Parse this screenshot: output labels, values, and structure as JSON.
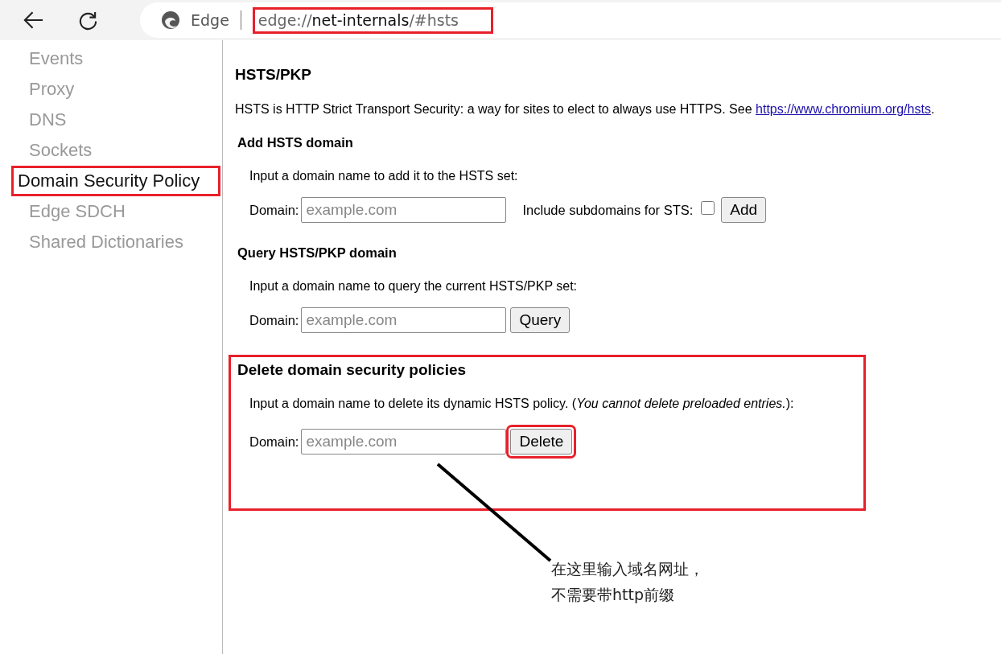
{
  "toolbar": {
    "brand": "Edge",
    "url": {
      "scheme": "edge://",
      "host": "net-internals",
      "path": "/#hsts",
      "highlighted": true
    }
  },
  "sidebar": {
    "items": [
      {
        "label": "Events",
        "selected": false,
        "highlighted": false
      },
      {
        "label": "Proxy",
        "selected": false,
        "highlighted": false
      },
      {
        "label": "DNS",
        "selected": false,
        "highlighted": false
      },
      {
        "label": "Sockets",
        "selected": false,
        "highlighted": false
      },
      {
        "label": "Domain Security Policy",
        "selected": true,
        "highlighted": true
      },
      {
        "label": "Edge SDCH",
        "selected": false,
        "highlighted": false
      },
      {
        "label": "Shared Dictionaries",
        "selected": false,
        "highlighted": false
      }
    ]
  },
  "page": {
    "title": "HSTS/PKP",
    "intro": "HSTS is HTTP Strict Transport Security: a way for sites to elect to always use HTTPS. See",
    "intro_link": "https://www.chromium.org/hsts",
    "intro_end": ".",
    "sections": [
      {
        "kind": "add",
        "heading": "Add HSTS domain",
        "description": "Input a domain name to add it to the HSTS set:",
        "highlighted": false,
        "domain_label": "Domain:",
        "placeholder": "example.com",
        "checkbox_label": "Include subdomains for STS:",
        "checked": false,
        "button": {
          "label": "Add",
          "highlighted": false
        }
      },
      {
        "kind": "query",
        "heading": "Query HSTS/PKP domain",
        "description": "Input a domain name to query the current HSTS/PKP set:",
        "highlighted": false,
        "domain_label": "Domain:",
        "placeholder": "example.com",
        "button": {
          "label": "Query",
          "highlighted": false
        }
      },
      {
        "kind": "delete",
        "heading": "Delete domain security policies",
        "description": "Input a domain name to delete its dynamic HSTS policy. (*You cannot delete preloaded entries.*):",
        "highlighted": true,
        "domain_label": "Domain:",
        "placeholder": "example.com",
        "button": {
          "label": "Delete",
          "highlighted": true
        }
      }
    ]
  },
  "annotation": {
    "note_lines": [
      "在这里输入域名网址，",
      "不需要带http前缀"
    ]
  }
}
